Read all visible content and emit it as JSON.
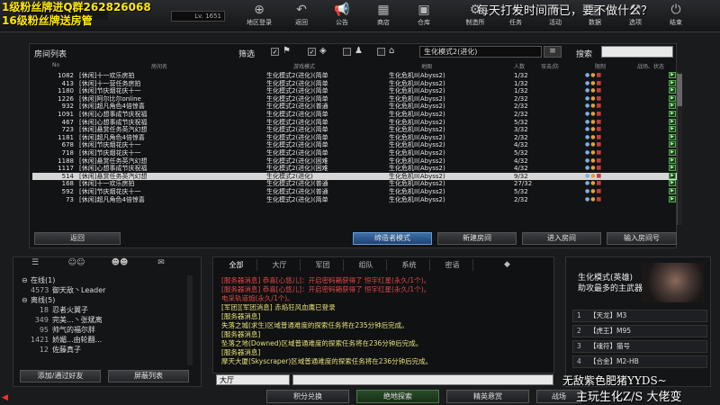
{
  "stream": {
    "top_left_line1": "1级粉丝牌进Q群262826068",
    "top_left_line2": "16级粉丝牌送房管",
    "top_right": "每天打发时间而已，要不做什么？",
    "bottom_right_line1": "无敌紫色肥猪YYDS~",
    "bottom_right_line2": "主玩生化Z/S 大佬变"
  },
  "player": {
    "level": "Lv. 1651"
  },
  "nav": [
    {
      "label": "地区登录",
      "icon": "globe-icon",
      "glyph": "⊕"
    },
    {
      "label": "返回",
      "icon": "back-icon",
      "glyph": "↶"
    },
    {
      "label": "公告",
      "icon": "megaphone-icon",
      "glyph": "📢"
    },
    {
      "label": "商店",
      "icon": "shop-icon",
      "glyph": "▦"
    },
    {
      "label": "仓库",
      "icon": "warehouse-icon",
      "glyph": "▣"
    },
    {
      "label": "制造所",
      "icon": "forge-icon",
      "glyph": "⚙"
    },
    {
      "label": "任务",
      "icon": "mission-icon",
      "glyph": "✦"
    },
    {
      "label": "活动",
      "icon": "event-icon",
      "glyph": "★"
    },
    {
      "label": "数据",
      "icon": "data-icon",
      "glyph": "▤"
    },
    {
      "label": "选项",
      "icon": "options-icon",
      "glyph": "⚒"
    },
    {
      "label": "结束",
      "icon": "exit-icon",
      "glyph": "⏻"
    }
  ],
  "room_list": {
    "title": "房间列表",
    "filter_label": "筛选",
    "mode_select": "生化模式2(进化)",
    "search_label": "搜索",
    "search_value": "",
    "columns": {
      "no": "No",
      "name": "房间名",
      "mode": "游戏模式",
      "map": "地图",
      "count": "人数",
      "state": "攻击/防",
      "limit": "限制",
      "extra": "战场、状态"
    },
    "rows": [
      {
        "no": "1082",
        "name": "[休闲]十一欢乐房拍",
        "mode": "生化模式2(进化)(简单",
        "map": "生化危机II(Abyss2)",
        "count": "1/32",
        "selected": false
      },
      {
        "no": "413",
        "name": "[休闲]十一营任务房拍",
        "mode": "生化模式2(进化)(简单",
        "map": "生化危机II(Abyss2)",
        "count": "1/32",
        "selected": false
      },
      {
        "no": "1180",
        "name": "[休闲]节庆烟花庆十一",
        "mode": "生化模式2(进化)(简单",
        "map": "生化危机II(Abyss2)",
        "count": "1/32",
        "selected": false
      },
      {
        "no": "1226",
        "name": "[休闲]阿尔比尔online",
        "mode": "生化模式2(进化)(简单",
        "map": "生化危机II(Abyss2)",
        "count": "2/32",
        "selected": false
      },
      {
        "no": "932",
        "name": "[休闲]超凡角色4倍惊喜",
        "mode": "生化模式2(进化)(普通",
        "map": "生化危机II(Abyss2)",
        "count": "2/32",
        "selected": false
      },
      {
        "no": "1091",
        "name": "[休闲]心想事成节庆祝福",
        "mode": "生化模式2(进化)(简单",
        "map": "生化危机II(Abyss2)",
        "count": "2/32",
        "selected": false
      },
      {
        "no": "467",
        "name": "[休闲]心想事成节庆祝福",
        "mode": "生化模式2(进化)(简单",
        "map": "生化危机II(Abyss2)",
        "count": "5/32",
        "selected": false
      },
      {
        "no": "723",
        "name": "[休闲]悬赏任务英汽幻想",
        "mode": "生化模式2(进化)(简单",
        "map": "生化危机II(Abyss2)",
        "count": "3/32",
        "selected": false
      },
      {
        "no": "1181",
        "name": "[休闲]超凡角色4倍惊喜",
        "mode": "生化模式2(进化)(简单",
        "map": "生化危机II(Abyss2)",
        "count": "2/32",
        "selected": false
      },
      {
        "no": "678",
        "name": "[休闲]节庆烟花庆十一",
        "mode": "生化模式2(进化)(简单",
        "map": "生化危机II(Abyss2)",
        "count": "4/32",
        "selected": false
      },
      {
        "no": "718",
        "name": "[休闲]节庆烟花庆十一",
        "mode": "生化模式2(进化)(简单",
        "map": "生化危机II(Abyss2)",
        "count": "5/32",
        "selected": false
      },
      {
        "no": "1188",
        "name": "[休闲]悬赏任务英汽幻想",
        "mode": "生化模式2(进化)(困难",
        "map": "生化危机II(Abyss2)",
        "count": "4/32",
        "selected": false
      },
      {
        "no": "1117",
        "name": "[休闲]心想事成节庆祝福",
        "mode": "生化模式2(进化)(困难",
        "map": "生化危机II(Abyss2)",
        "count": "4/32",
        "selected": false
      },
      {
        "no": "514",
        "name": "[休闲]悬赏任务英汽幻想",
        "mode": "生化模式2(进化)",
        "map": "生化危机II(Abyss2)",
        "count": "9/32",
        "selected": true
      },
      {
        "no": "168",
        "name": "[休闲]十一欢乐房拍",
        "mode": "生化模式2(进化)(普通",
        "map": "生化危机II(Abyss2)",
        "count": "27/32",
        "selected": false
      },
      {
        "no": "592",
        "name": "[休闲]节庆烟花庆十一",
        "mode": "生化模式2(进化)(普通",
        "map": "生化危机II(Abyss2)",
        "count": "5/32",
        "selected": false
      },
      {
        "no": "73",
        "name": "[休闲]超凡角色4倍惊喜",
        "mode": "生化模式2(进化)(简单",
        "map": "生化危机II(Abyss2)",
        "count": "2/32",
        "selected": false
      }
    ],
    "buttons": {
      "back": "返回",
      "sniper_mode": "缔造者模式",
      "new_room": "新建房间",
      "enter_room": "进入房间",
      "enter_number": "输入房间号"
    }
  },
  "friends": {
    "online_label": "在线",
    "online_count": "(1)",
    "offline_label": "离线",
    "offline_count": "(5)",
    "online": [
      {
        "level": "4573",
        "name": "御天敌丶Leader"
      }
    ],
    "offline": [
      {
        "level": "18",
        "name": "忍者火翼子"
      },
      {
        "level": "349",
        "name": "完美...丶张斌离"
      },
      {
        "level": "95",
        "name": "帅气的福尔胖"
      },
      {
        "level": "1421",
        "name": "娇媚...由轮翻..."
      },
      {
        "level": "12",
        "name": "佐藤真子"
      }
    ],
    "add_button": "添加/通过好友",
    "block_button": "屏蔽列表"
  },
  "chat": {
    "tabs": [
      "全部",
      "大厅",
      "军团",
      "组队",
      "系统",
      "密语"
    ],
    "lines": [
      {
        "color": "red",
        "text": "[服务器消息] 恭喜[心悠儿]：开启密码箱获得了 恒宇红星(永久/1个)。"
      },
      {
        "color": "red",
        "text": "[服务器消息] 恭喜[心悠儿]：开启密码箱获得了 恒宇红星(永久/1个)。"
      },
      {
        "color": "red",
        "text": "电采轨道炮(永久/1个)。"
      },
      {
        "color": "yel",
        "text": "[军团][军团消息] 赤焰狂风血鹰已登录"
      },
      {
        "color": "yel",
        "text": "[服务器消息]"
      },
      {
        "color": "yel",
        "text": "失落之城(求生)区域普通难度的探索任务将在235分钟后完成。"
      },
      {
        "color": "yel",
        "text": "[服务器消息]"
      },
      {
        "color": "yel",
        "text": "坠落之地(Downed)区域普通难度的探索任务将在236分钟后完成。"
      },
      {
        "color": "yel",
        "text": "[服务器消息]"
      },
      {
        "color": "yel",
        "text": "摩天大厦(Skyscraper)区域普通难度的探索任务将在236分钟后完成。"
      }
    ],
    "channel": "大厅",
    "input_value": ""
  },
  "mission": {
    "title_line1": "生化模式(英雄)",
    "title_line2": "助攻最多的主武器",
    "rows": [
      {
        "idx": "1",
        "text": "【天龙】M3"
      },
      {
        "idx": "2",
        "text": "【虎王】M95"
      },
      {
        "idx": "3",
        "text": "【魂符】猫号"
      },
      {
        "idx": "4",
        "text": "【合金】M2-HB"
      }
    ]
  },
  "bottom_bar": {
    "points": "积分兑换",
    "explore": "绝地探索",
    "elite": "精英悬赏",
    "battle": "战场"
  },
  "colors": {
    "accent_blue": "#3d6fa8",
    "chat_red": "#e24848",
    "chat_yellow": "#e6e07a",
    "stream_yellow": "#ffea00"
  }
}
